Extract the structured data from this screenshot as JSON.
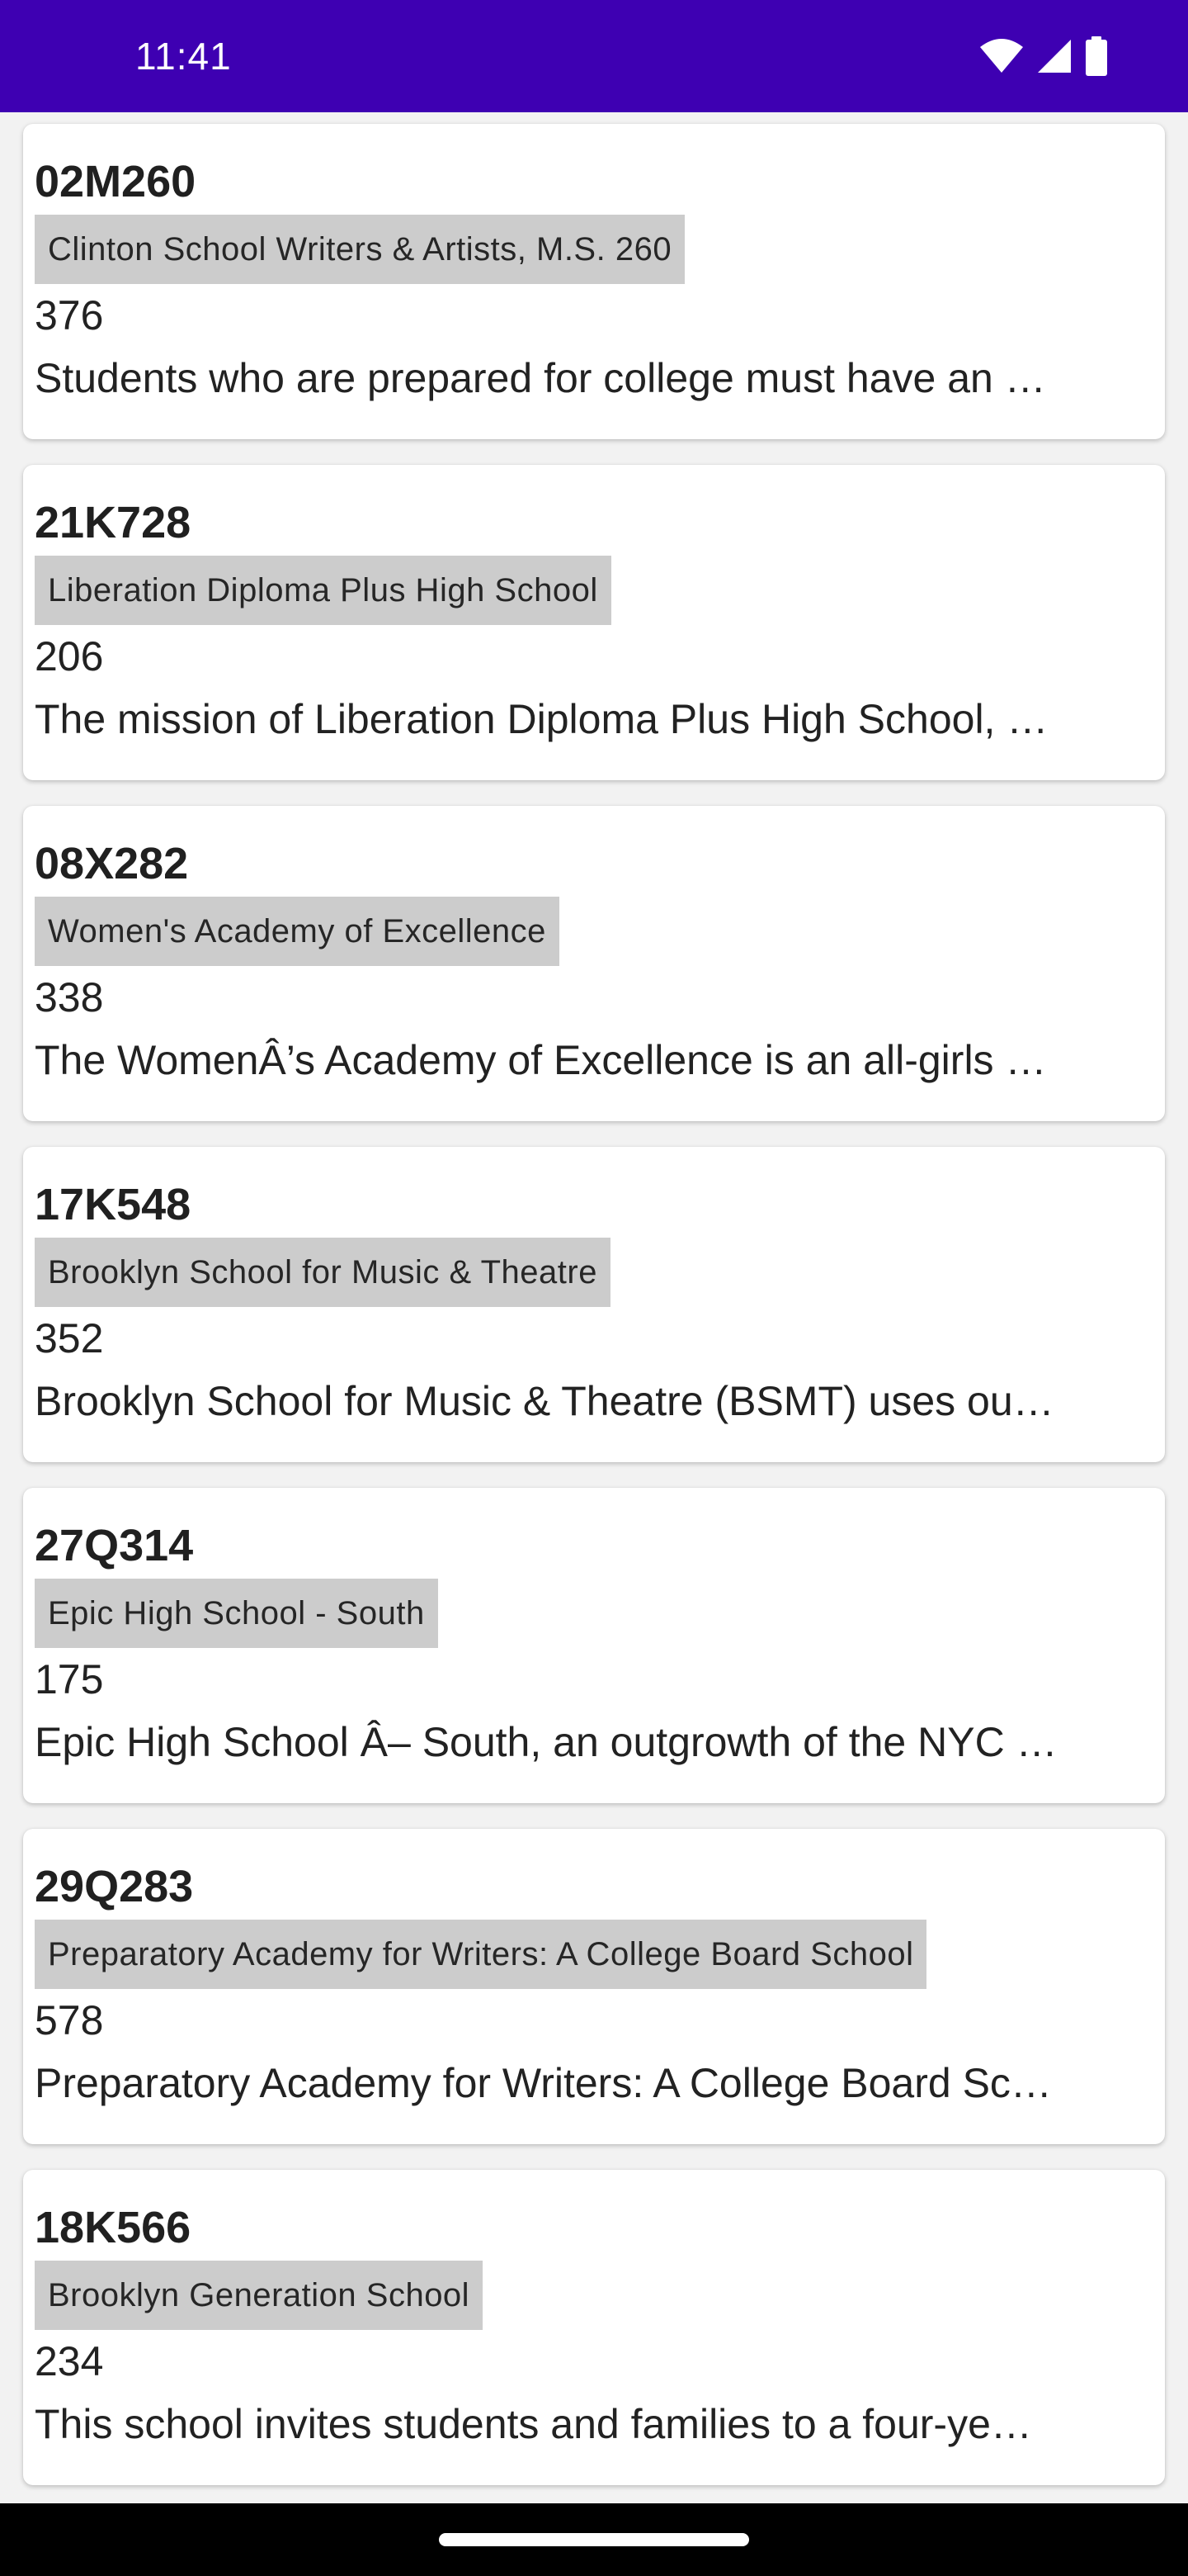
{
  "status_bar": {
    "time": "11:41",
    "icons": [
      "wifi-icon",
      "cellular-signal-icon",
      "battery-icon"
    ],
    "background_color": "#3e00b2"
  },
  "schools": [
    {
      "code": "02M260",
      "name": "Clinton School Writers & Artists, M.S. 260",
      "count": "376",
      "overview": "Students who are prepared for college must have an …"
    },
    {
      "code": "21K728",
      "name": "Liberation Diploma Plus High School",
      "count": "206",
      "overview": "The mission of Liberation Diploma Plus High School, …"
    },
    {
      "code": "08X282",
      "name": "Women's Academy of Excellence",
      "count": "338",
      "overview": "The WomenÂ’s Academy of Excellence is an all-girls …"
    },
    {
      "code": "17K548",
      "name": "Brooklyn School for Music & Theatre",
      "count": "352",
      "overview": "Brooklyn School for Music & Theatre (BSMT) uses ou…"
    },
    {
      "code": "27Q314",
      "name": "Epic High School - South",
      "count": "175",
      "overview": "Epic High School Â– South, an outgrowth of the NYC …"
    },
    {
      "code": "29Q283",
      "name": "Preparatory Academy for Writers: A College Board School",
      "count": "578",
      "overview": "Preparatory Academy for Writers: A College Board Sc…"
    },
    {
      "code": "18K566",
      "name": "Brooklyn Generation School",
      "count": "234",
      "overview": "This school invites students and families to a four-ye…"
    }
  ]
}
